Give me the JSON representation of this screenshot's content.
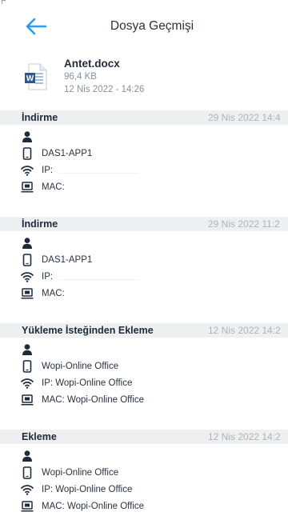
{
  "header": {
    "title": "Dosya Geçmişi",
    "back_icon": "arrow-left-icon",
    "accent_color": "#2a9df4"
  },
  "file": {
    "name": "Antet.docx",
    "size": "96,4 KB",
    "date": "12 Nis 2022 - 14:26",
    "icon": "word-document-icon",
    "icon_color": "#2b579a"
  },
  "history": [
    {
      "title": "İndirme",
      "date": "29 Nis 2022 14:4",
      "device": "DAS1-APP1",
      "ip_label": "IP:",
      "ip_value": "",
      "mac_label": "MAC:",
      "mac_value": ""
    },
    {
      "title": "İndirme",
      "date": "29 Nis 2022 11:2",
      "device": "DAS1-APP1",
      "ip_label": "IP:",
      "ip_value": "",
      "mac_label": "MAC:",
      "mac_value": ""
    },
    {
      "title": "Yükleme İsteğinden Ekleme",
      "date": "12 Nis 2022 14:2",
      "device": "Wopi-Online Office",
      "ip_label": "IP:",
      "ip_value": "Wopi-Online Office",
      "mac_label": "MAC:",
      "mac_value": "Wopi-Online Office"
    },
    {
      "title": "Ekleme",
      "date": "12 Nis 2022 14:2",
      "device": "Wopi-Online Office",
      "ip_label": "IP:",
      "ip_value": "Wopi-Online Office",
      "mac_label": "MAC:",
      "mac_value": "Wopi-Online Office"
    }
  ]
}
